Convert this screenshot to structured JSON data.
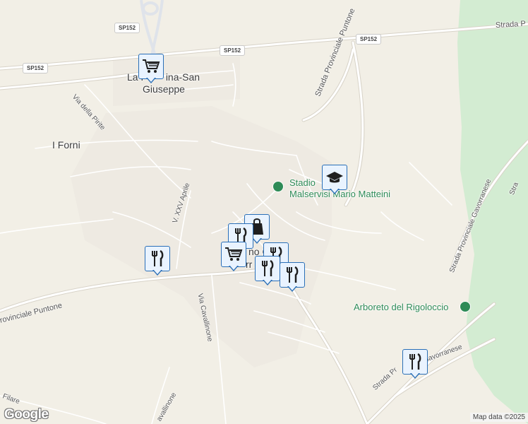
{
  "map": {
    "colors": {
      "land": "#f2efe6",
      "park": "#d3ecd2",
      "road": "#ffffff",
      "road_outline": "#d8d3c8",
      "motorway": "#dfe3ea",
      "marker_border": "#2a6fb7",
      "marker_fill": "#e9f3ff",
      "poi_green": "#2e8b57"
    },
    "place_labels": {
      "la_pecorina_a": "La P",
      "la_pecorina_b": "ina-San",
      "giuseppe": "Giuseppe",
      "i_forni": "I Forni",
      "town_a": "no C",
      "town_b": "rr"
    },
    "poi_labels": {
      "stadio_a": "Stadio",
      "stadio_b": "Malservisi Mario Matteini",
      "arboreto": "Arboreto del Rigoloccio"
    },
    "road_labels": {
      "strada_puntone": "Strada Provinciale Puntone",
      "strada_top_right": "Strada P",
      "strada_gavorranese": "Strada Provinciale Gavorranese",
      "strada_gav_bottom": "Strada Pr",
      "gavorranese_tail": "Gavorranese",
      "strada_right_edge": "Stra",
      "via_pirite": "Via della Pirite",
      "via_xxv_aprile": "V. XXV Aprile",
      "via_cavallinone": "Via Cavallinone",
      "via_cavallinone_2": "avallinone",
      "puntone_left": "rovinciale Puntone",
      "via_filare": "Filare"
    },
    "shields": {
      "sp152_a": "SP152",
      "sp152_b": "SP152",
      "sp152_c": "SP152",
      "sp152_d": "SP152"
    },
    "markers": {
      "shopping_cart_north": "shopping-cart-icon",
      "shopping_cart_center": "shopping-cart-icon",
      "shopping_bag": "shopping-bag-icon",
      "school": "graduation-cap-icon",
      "restaurants": "fork-knife-icon"
    },
    "logo": "Google",
    "attribution": "Map data ©2025"
  }
}
